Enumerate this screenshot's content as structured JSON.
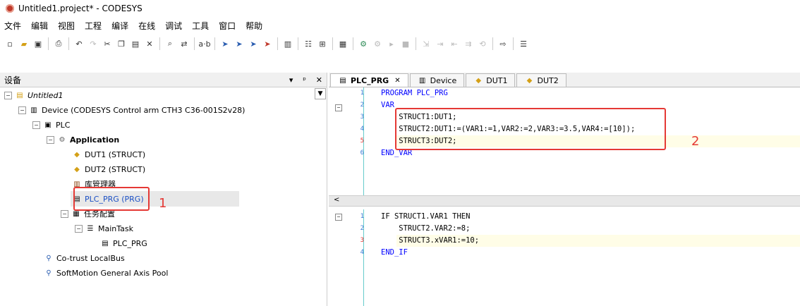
{
  "window": {
    "title": "Untitled1.project* - CODESYS"
  },
  "menu": [
    "文件",
    "编辑",
    "视图",
    "工程",
    "编译",
    "在线",
    "调试",
    "工具",
    "窗口",
    "帮助"
  ],
  "toolbar": [
    "new",
    "open",
    "save",
    "print",
    "undo",
    "redo",
    "cut",
    "copy",
    "paste",
    "delete",
    "find",
    "replace",
    "ab",
    "bookmark-1",
    "bookmark-2",
    "bookmark-3",
    "bookmark-4",
    "window",
    "config",
    "add",
    "step",
    "grid",
    "login",
    "logout",
    "run",
    "stop",
    "step-a",
    "step-b",
    "step-c",
    "step-d",
    "step-e",
    "arrow",
    "tray"
  ],
  "devices_panel": {
    "title": "设备",
    "controls": [
      "▾",
      "ᵖ",
      "✕"
    ],
    "tree": [
      {
        "label": "Untitled1",
        "italic": true
      },
      {
        "label": "Device (CODESYS Control arm CTH3 C36-001S2v28)"
      },
      {
        "label": "PLC"
      },
      {
        "label": "Application",
        "bold": true
      },
      {
        "label": "DUT1 (STRUCT)"
      },
      {
        "label": "DUT2 (STRUCT)"
      },
      {
        "label": "库管理器"
      },
      {
        "label": "PLC_PRG (PRG)",
        "selected": true
      },
      {
        "label": "任务配置"
      },
      {
        "label": "MainTask"
      },
      {
        "label": "PLC_PRG"
      },
      {
        "label": "Co-trust LocalBus"
      },
      {
        "label": "SoftMotion General Axis Pool"
      }
    ],
    "annotation": "1"
  },
  "tabs": [
    {
      "label": "PLC_PRG",
      "active": true
    },
    {
      "label": "Device"
    },
    {
      "label": "DUT1"
    },
    {
      "label": "DUT2"
    }
  ],
  "decl_editor": {
    "lines": [
      {
        "n": "1",
        "t": "PROGRAM PLC_PRG"
      },
      {
        "n": "2",
        "t": "VAR"
      },
      {
        "n": "3",
        "t": "    STRUCT1:DUT1;"
      },
      {
        "n": "4",
        "t": "    STRUCT2:DUT1:=(VAR1:=1,VAR2:=2,VAR3:=3.5,VAR4:=[10]);"
      },
      {
        "n": "5",
        "t": "    STRUCT3:DUT2;"
      },
      {
        "n": "6",
        "t": "END_VAR"
      }
    ],
    "annotation": "2"
  },
  "impl_editor": {
    "lines": [
      {
        "n": "1",
        "t": "IF STRUCT1.VAR1 THEN"
      },
      {
        "n": "2",
        "t": "    STRUCT2.VAR2:=8;"
      },
      {
        "n": "3",
        "t": "    STRUCT3.xVAR1:=10;"
      },
      {
        "n": "4",
        "t": "END_IF"
      }
    ]
  },
  "splitter_arrow": "<",
  "colors": {
    "accent": "#e53935",
    "keyword": "#0000ff",
    "number": "#ff0000",
    "line_number": "#3a7bd5"
  }
}
